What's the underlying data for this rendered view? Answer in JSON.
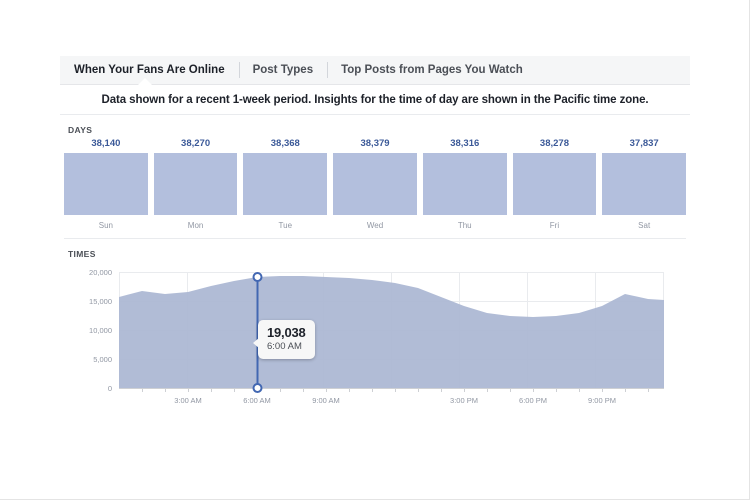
{
  "tabs": [
    {
      "label": "When Your Fans Are Online",
      "active": true
    },
    {
      "label": "Post Types",
      "active": false
    },
    {
      "label": "Top Posts from Pages You Watch",
      "active": false
    }
  ],
  "subtitle": "Data shown for a recent 1-week period. Insights for the time of day are shown in the Pacific time zone.",
  "sections": {
    "days_label": "DAYS",
    "times_label": "TIMES"
  },
  "tooltip": {
    "value": "19,038",
    "time": "6:00 AM"
  },
  "colors": {
    "bar_fill": "#b3bfdd",
    "area_fill": "#aab6d3",
    "value_text": "#3b5998",
    "marker": "#4267b2",
    "header_bg": "#f5f6f7"
  },
  "chart_data": [
    {
      "type": "bar",
      "title": "DAYS",
      "xlabel": "",
      "ylabel": "",
      "categories": [
        "Sun",
        "Mon",
        "Tue",
        "Wed",
        "Thu",
        "Fri",
        "Sat"
      ],
      "values": [
        38140,
        38270,
        38368,
        38379,
        38316,
        38278,
        37837
      ],
      "value_labels": [
        "38,140",
        "38,270",
        "38,368",
        "38,379",
        "38,316",
        "38,278",
        "37,837"
      ],
      "grid": false,
      "legend": "none",
      "note": "Bars rendered at uniform full height in the UI; labels above each bar carry the value."
    },
    {
      "type": "area",
      "title": "TIMES",
      "xlabel": "",
      "ylabel": "",
      "ylim": [
        0,
        20000
      ],
      "yticks": [
        0,
        5000,
        10000,
        15000,
        20000
      ],
      "ytick_labels": [
        "0",
        "5,000",
        "10,000",
        "15,000",
        "20,000"
      ],
      "xticks": [
        3,
        6,
        9,
        15,
        18,
        21
      ],
      "xtick_labels": [
        "3:00 AM",
        "6:00 AM",
        "9:00 AM",
        "3:00 PM",
        "6:00 PM",
        "9:00 PM"
      ],
      "grid": true,
      "legend": "none",
      "x": [
        0,
        1,
        2,
        3,
        4,
        5,
        6,
        7,
        8,
        9,
        10,
        11,
        12,
        13,
        14,
        15,
        16,
        17,
        18,
        19,
        20,
        21,
        22,
        23
      ],
      "values": [
        15700,
        16700,
        16250,
        16500,
        17600,
        18500,
        19038,
        19300,
        19300,
        19150,
        18900,
        18550,
        18100,
        17200,
        15700,
        14100,
        12900,
        12350,
        12200,
        12350,
        12900,
        14200,
        16300,
        15500
      ],
      "annotations": [
        {
          "x": 6,
          "y": 19038,
          "label": "19,038",
          "sublabel": "6:00 AM"
        }
      ]
    }
  ]
}
